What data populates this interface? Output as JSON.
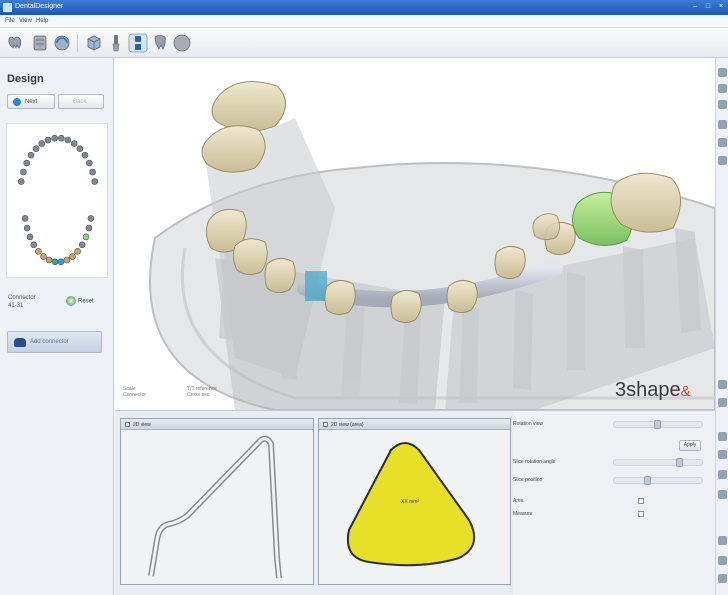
{
  "window": {
    "title": "DentalDesigner"
  },
  "menu": [
    "File",
    "View",
    "Help"
  ],
  "toolbar": {
    "buttons": [
      "teeth-icon",
      "model-icon",
      "scan-icon",
      "box-icon",
      "tool-icon",
      "connector-icon",
      "tooth-icon",
      "sphere-icon"
    ]
  },
  "left_panel": {
    "title": "Design",
    "next_label": "Next",
    "back_label": "Back",
    "connector_label": "Connector",
    "connector_value": "41-31",
    "reset_label": "Reset",
    "add_connector_label": "Add connector"
  },
  "viewport": {
    "info_left_1": "Scale",
    "info_left_2": "Connector",
    "info_mid_1": "T/T reference",
    "info_mid_2": "Cross sec",
    "brand": "3shape",
    "brand_mark": "&"
  },
  "bottom": {
    "pane1_title": "2D view",
    "pane2_title": "2D view (area)",
    "area_text": "XX mm²"
  },
  "properties": {
    "rows": [
      {
        "label": "Rotation view"
      },
      {
        "label": "Slice rotation angle"
      },
      {
        "label": "Slice position"
      },
      {
        "label": "Area"
      },
      {
        "label": "Measure"
      }
    ],
    "apply_label": "Apply"
  },
  "colors": {
    "titlebar": "#2b66c6",
    "highlight_tooth": "#8fd27a",
    "cross_section": "#e6e128"
  }
}
